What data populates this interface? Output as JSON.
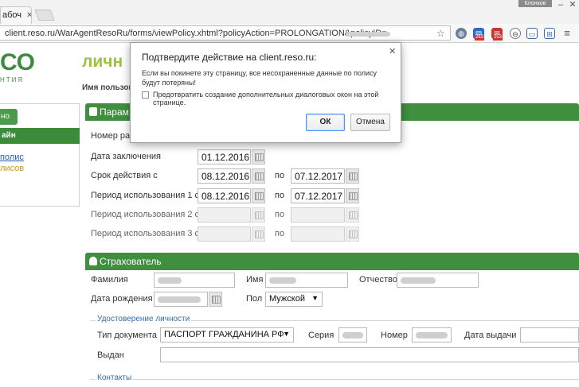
{
  "browser": {
    "tab_title": "абоч",
    "url": "client.reso.ru/WarAgentResoRu/forms/viewPolicy.xhtml?policyAction=PROLONGATION&policyID=",
    "profile_name": "Клонков",
    "extensions": [
      {
        "icon": "globe-icon",
        "color": "#6b7f99"
      },
      {
        "icon": "notes-icon",
        "color": "#2a6cc4",
        "badge": "263"
      },
      {
        "icon": "mail-icon",
        "color": "#c8352c",
        "badge": "253"
      },
      {
        "icon": "sync-icon",
        "color": "#666666"
      },
      {
        "icon": "screen-icon",
        "color": "#3b67a6"
      },
      {
        "icon": "grid-icon",
        "color": "#2f6fb8"
      },
      {
        "icon": "menu-icon",
        "color": "#777777"
      }
    ]
  },
  "page": {
    "logo_text": "CO",
    "logo_sub": "НТИЯ",
    "title": "личн",
    "user_label": "Имя пользов"
  },
  "sidebar": {
    "tab_label": "но",
    "header": "айн",
    "link1": "полис",
    "link2": "лисов"
  },
  "params": {
    "header": "Парам",
    "labels": {
      "number": "Номер рас",
      "conclusion_date": "Дата заключения",
      "validity": "Срок действия с",
      "period1": "Период использования 1 с",
      "period2": "Период использования 2 с",
      "period3": "Период использования 3 с",
      "to": "по"
    },
    "conclusion_date": "01.12.2016",
    "validity_from": "08.12.2016",
    "validity_to": "07.12.2017",
    "period1_from": "08.12.2016",
    "period1_to": "07.12.2017"
  },
  "insurer": {
    "header": "Страхователь",
    "surname_label": "Фамилия",
    "name_label": "Имя",
    "patronymic_label": "Отчество",
    "birth_label": "Дата рождения",
    "gender_label": "Пол",
    "gender_value": "Мужской",
    "id_group": "Удостоверение личности",
    "doc_type_label": "Тип документа",
    "doc_type_value": "ПАСПОРТ ГРАЖДАНИНА РФ",
    "series_label": "Серия",
    "number_label": "Номер",
    "issue_date_label": "Дата выдачи",
    "issued_by_label": "Выдан",
    "contacts_group": "Контакты"
  },
  "dialog": {
    "title": "Подтвердите действие на client.reso.ru:",
    "message": "Если вы покинете эту страницу, все несохраненные данные по полису будут потеряны!",
    "checkbox_label": "Предотвратить создание дополнительных диалоговых окон на этой странице.",
    "ok_label": "ОК",
    "cancel_label": "Отмена"
  }
}
